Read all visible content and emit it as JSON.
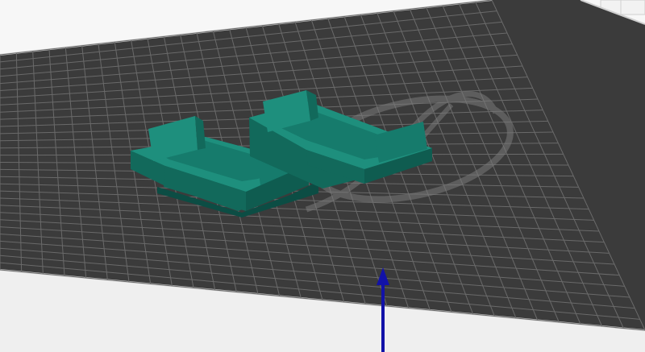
{
  "app": {
    "view": "3d-viewport"
  },
  "colors": {
    "background": "#f7f7f7",
    "bed_surface": "#3b3b3b",
    "grid_lines": "#6a6a6a",
    "bed_edge": "#c4c4c4",
    "model_fill": "#1e8f7d",
    "model_dark": "#12695b",
    "model_light": "#27a28f",
    "z_axis": "#1212a8",
    "logo": "#8a8a8a"
  },
  "scene": {
    "objects": [
      {
        "name": "box-part-1",
        "type": "model"
      },
      {
        "name": "box-part-2",
        "type": "model"
      }
    ],
    "axis": {
      "name": "z-axis-arrow"
    },
    "icons": [
      "build-plate-logo-icon",
      "z-axis-arrow-icon"
    ]
  }
}
